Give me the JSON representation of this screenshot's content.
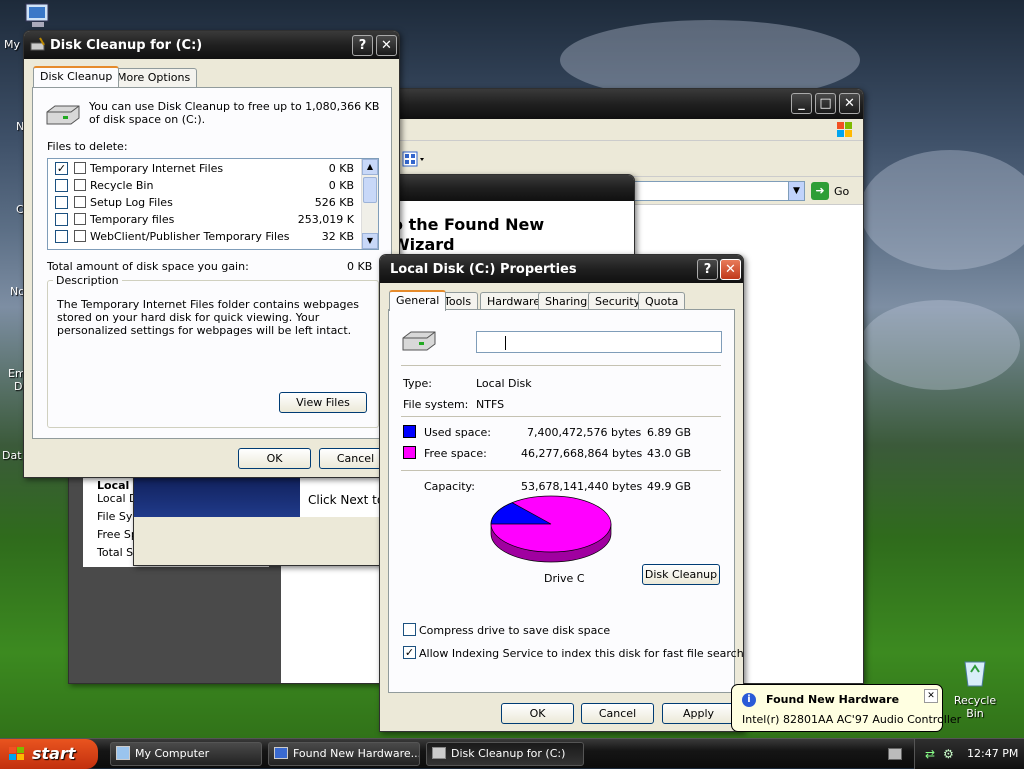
{
  "desktop": {
    "icons": [
      {
        "label": "My"
      },
      {
        "label": "N"
      },
      {
        "label": "C"
      },
      {
        "label": "No"
      },
      {
        "label": "Em"
      },
      {
        "label": "D"
      },
      {
        "label": "Dat"
      }
    ],
    "recycle_bin": "Recycle Bin"
  },
  "bg_window": {
    "wizard_title_line1": "o the Found New",
    "wizard_title_line2": "Wizard",
    "click_next": "Click Next to c",
    "go_label": "Go",
    "side_items": [
      "Local D",
      "Local Di",
      "File Sys",
      "Free Sp",
      "Total Si"
    ]
  },
  "disk_cleanup": {
    "title": "Disk Cleanup for  (C:)",
    "tabs": [
      "Disk Cleanup",
      "More Options"
    ],
    "intro": "You can use Disk Cleanup to free up to 1,080,366 KB of disk space on  (C:).",
    "files_to_delete_label": "Files to delete:",
    "files": [
      {
        "name": "Temporary Internet Files",
        "size": "0 KB",
        "checked": true
      },
      {
        "name": "Recycle Bin",
        "size": "0 KB",
        "checked": false
      },
      {
        "name": "Setup Log Files",
        "size": "526 KB",
        "checked": false
      },
      {
        "name": "Temporary files",
        "size": "253,019 K",
        "checked": false
      },
      {
        "name": "WebClient/Publisher Temporary Files",
        "size": "32 KB",
        "checked": false
      }
    ],
    "total_label": "Total amount of disk space you gain:",
    "total_value": "0 KB",
    "description_label": "Description",
    "description": "The Temporary Internet Files folder contains webpages stored on your hard disk for quick viewing. Your personalized settings for webpages will be left intact.",
    "view_files": "View Files",
    "ok": "OK",
    "cancel": "Cancel"
  },
  "properties": {
    "title": "Local Disk (C:) Properties",
    "tabs": [
      "General",
      "Tools",
      "Hardware",
      "Sharing",
      "Security",
      "Quota"
    ],
    "type_label": "Type:",
    "type_value": "Local Disk",
    "fs_label": "File system:",
    "fs_value": "NTFS",
    "used_label": "Used space:",
    "used_bytes": "7,400,472,576 bytes",
    "used_gb": "6.89 GB",
    "free_label": "Free space:",
    "free_bytes": "46,277,668,864 bytes",
    "free_gb": "43.0 GB",
    "capacity_label": "Capacity:",
    "capacity_bytes": "53,678,141,440 bytes",
    "capacity_gb": "49.9 GB",
    "drive_label": "Drive C",
    "disk_cleanup_btn": "Disk Cleanup",
    "compress_label": "Compress drive to save disk space",
    "compress_checked": false,
    "index_label": "Allow Indexing Service to index this disk for fast file searching",
    "index_checked": true,
    "ok": "OK",
    "cancel": "Cancel",
    "apply": "Apply",
    "used_fraction": 0.138,
    "used_color": "#0000ff",
    "free_color": "#ff00ff"
  },
  "balloon": {
    "title": "Found New Hardware",
    "text": "Intel(r) 82801AA AC'97 Audio Controller"
  },
  "taskbar": {
    "start": "start",
    "buttons": [
      "My Computer",
      "Found New Hardware...",
      "Disk Cleanup for  (C:)"
    ],
    "clock": "12:47 PM"
  }
}
